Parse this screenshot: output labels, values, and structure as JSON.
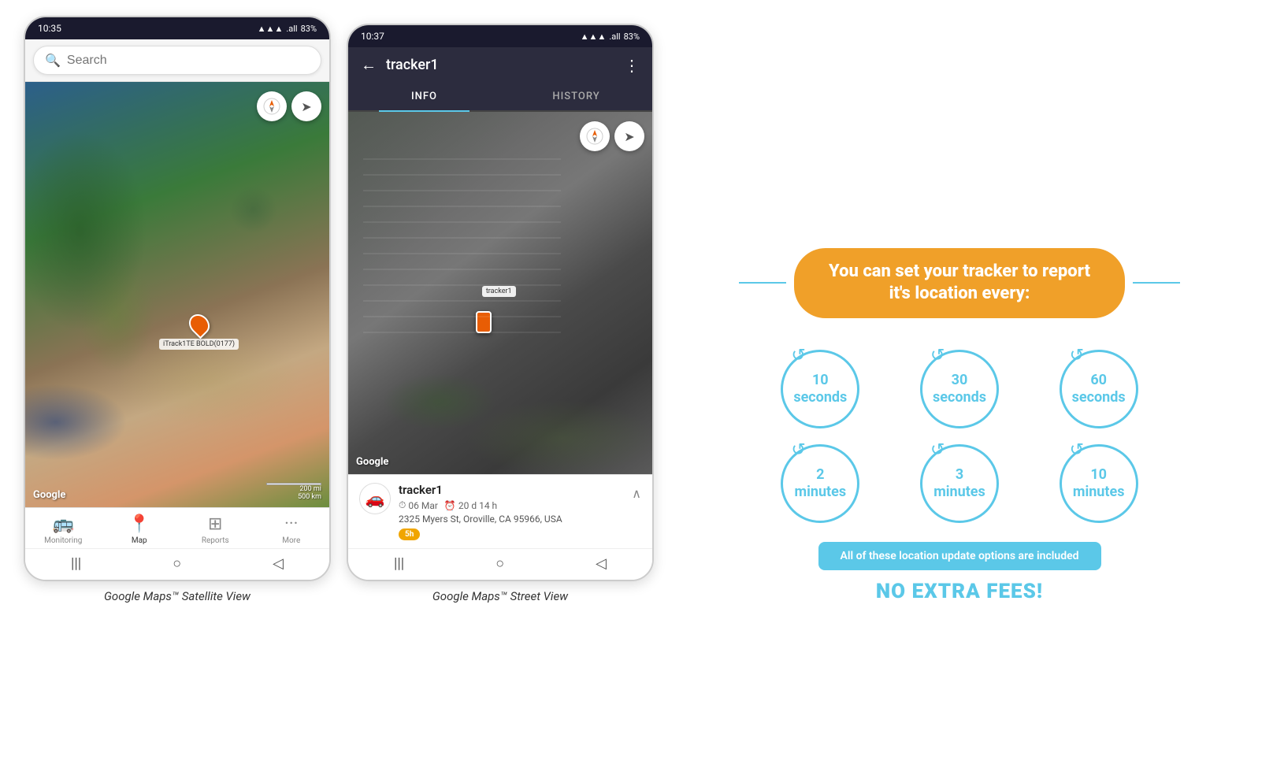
{
  "phone1": {
    "status_bar": {
      "time": "10:35",
      "signal": "▲▲▲",
      "network": ".all",
      "battery": "83%"
    },
    "search": {
      "placeholder": "Search"
    },
    "map": {
      "marker_label": "iTrack1TE BOLD(0177)",
      "google_logo": "Google",
      "scale_200mi": "200 mi",
      "scale_500km": "500 km"
    },
    "nav": {
      "items": [
        {
          "id": "monitoring",
          "label": "Monitoring",
          "icon": "🚌"
        },
        {
          "id": "map",
          "label": "Map",
          "icon": "📍",
          "active": true
        },
        {
          "id": "reports",
          "label": "Reports",
          "icon": "⊞"
        },
        {
          "id": "more",
          "label": "More",
          "icon": "···"
        }
      ]
    },
    "caption": "Google Maps™ Satellite View"
  },
  "phone2": {
    "status_bar": {
      "time": "10:37",
      "signal": "▲▲▲",
      "network": ".all",
      "battery": "83%"
    },
    "header": {
      "title": "tracker1",
      "back_icon": "←",
      "more_icon": "⋮"
    },
    "tabs": [
      {
        "id": "info",
        "label": "INFO",
        "active": true
      },
      {
        "id": "history",
        "label": "HISTORY",
        "active": false
      }
    ],
    "map": {
      "google_logo": "Google",
      "tracker_label": "tracker1"
    },
    "tracker_info": {
      "name": "tracker1",
      "date": "06 Mar",
      "duration": "20 d 14 h",
      "address": "2325 Myers St, Oroville, CA 95966, USA",
      "badge": "5h"
    },
    "caption": "Google Maps™ Street View"
  },
  "info_panel": {
    "headline": "You can set your tracker to report it's location every:",
    "circles": [
      {
        "id": "10sec",
        "line1": "10",
        "line2": "seconds"
      },
      {
        "id": "30sec",
        "line1": "30",
        "line2": "seconds"
      },
      {
        "id": "60sec",
        "line1": "60",
        "line2": "seconds"
      },
      {
        "id": "2min",
        "line1": "2",
        "line2": "minutes"
      },
      {
        "id": "3min",
        "line1": "3",
        "line2": "minutes"
      },
      {
        "id": "10min",
        "line1": "10",
        "line2": "minutes"
      }
    ],
    "footer_banner": "All of these location update options are included",
    "no_fees_label": "NO EXTRA FEES!",
    "accent_color": "#5bc8e8",
    "orange_color": "#f0a029"
  }
}
